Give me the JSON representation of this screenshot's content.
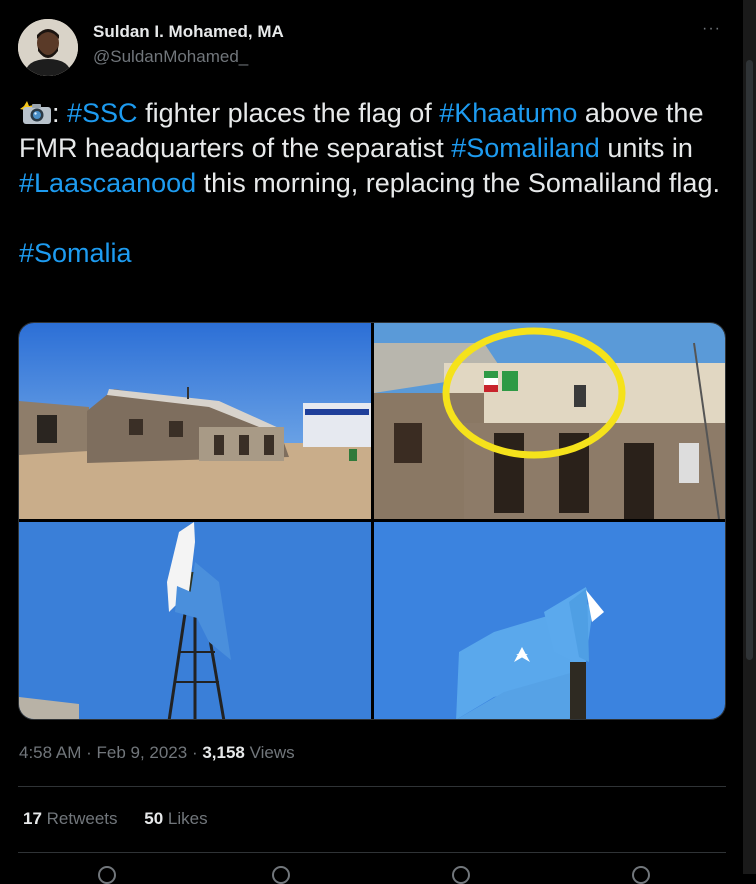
{
  "author": {
    "name": "Suldan I. Mohamed, MA",
    "handle": "@SuldanMohamed_"
  },
  "more_label": "···",
  "tweet": {
    "camera_icon": "camera-flash-icon",
    "t0": ": ",
    "h1": "#SSC",
    "t1": " fighter places the flag of ",
    "h2": "#Khaatumo",
    "t2": " above the FMR headquarters of the separatist ",
    "h3": "#Somaliland",
    "t3": " units in ",
    "h4": "#Laascaanood",
    "t4": " this morning, replacing the Somaliland flag.",
    "h5": "#Somalia"
  },
  "meta": {
    "time": "4:58 AM",
    "sep1": " · ",
    "date": "Feb 9, 2023",
    "sep2": " · ",
    "views_count": "3,158",
    "views_label": " Views"
  },
  "stats": {
    "retweets_count": "17",
    "retweets_label": " Retweets",
    "likes_count": "50",
    "likes_label": " Likes"
  },
  "colors": {
    "background": "#000000",
    "text": "#e7e9ea",
    "muted": "#71767b",
    "link": "#1d9bf0",
    "border": "#2f3336"
  }
}
